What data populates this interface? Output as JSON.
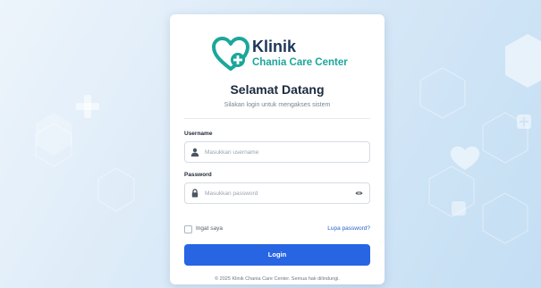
{
  "brand": {
    "name": "Klinik",
    "subtitle": "Chania Care Center",
    "logo_icon": "heart-plus-icon",
    "colors": {
      "primary": "#1c3658",
      "accent": "#1aa79a"
    }
  },
  "header": {
    "title": "Selamat Datang",
    "subtitle": "Silakan login untuk mengakses sistem"
  },
  "form": {
    "username": {
      "label": "Username",
      "placeholder": "Masukkan username",
      "value": "",
      "icon": "user-icon"
    },
    "password": {
      "label": "Password",
      "placeholder": "Masukkan password",
      "value": "",
      "icon": "lock-icon",
      "toggle_icon": "eye-icon"
    },
    "remember_label": "Ingat saya",
    "remember_checked": false,
    "forgot_label": "Lupa password?",
    "submit_label": "Login",
    "submit_color": "#2765e3"
  },
  "footer": {
    "text": "© 2025 Klinik Chania Care Center. Semua hak dilindungi."
  }
}
